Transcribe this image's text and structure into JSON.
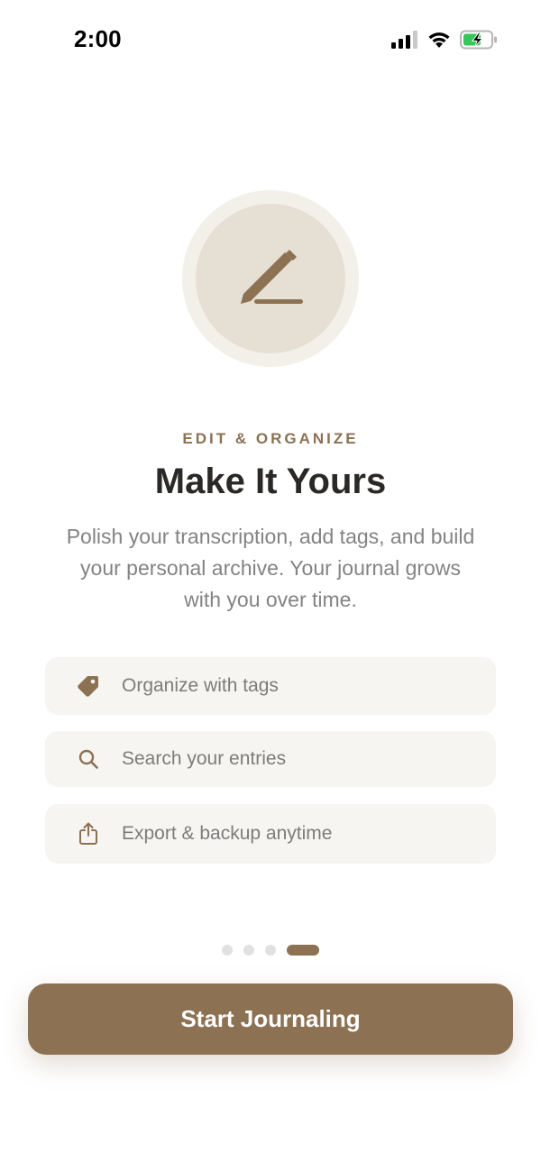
{
  "status_bar": {
    "time": "2:00",
    "icons": [
      "cellular-signal-icon",
      "wifi-icon",
      "battery-charging-icon"
    ]
  },
  "hero": {
    "icon": "pencil-icon"
  },
  "eyebrow": "EDIT & ORGANIZE",
  "title": "Make It Yours",
  "description": "Polish your transcription, add tags, and build your personal archive. Your journal grows with you over time.",
  "features": [
    {
      "icon": "tag-icon",
      "label": "Organize with tags"
    },
    {
      "icon": "search-icon",
      "label": "Search your entries"
    },
    {
      "icon": "share-icon",
      "label": "Export & backup anytime"
    }
  ],
  "pager": {
    "total": 4,
    "current": 4
  },
  "cta": {
    "label": "Start Journaling"
  },
  "colors": {
    "accent": "#8c7153",
    "hero_inner": "#e6dfd4",
    "hero_outer": "#f3f0ea",
    "card": "#f7f5f1",
    "title": "#2b2926",
    "body": "#838383"
  }
}
